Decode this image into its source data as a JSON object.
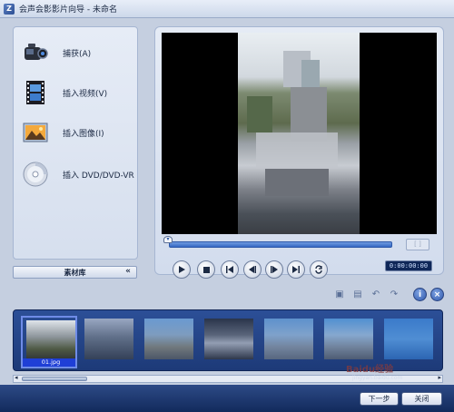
{
  "window": {
    "title": "会声会影影片向导 - 未命名"
  },
  "left_menu": {
    "items": [
      {
        "label": "捕获(A)",
        "icon": "camcorder-icon"
      },
      {
        "label": "插入视频(V)",
        "icon": "film-strip-icon"
      },
      {
        "label": "插入图像(I)",
        "icon": "picture-icon"
      },
      {
        "label": "插入 DVD/DVD-VR",
        "icon": "disc-icon"
      }
    ]
  },
  "library": {
    "label": "素材库"
  },
  "player": {
    "timecode": "0:00:00:00",
    "controls": [
      "play",
      "stop",
      "home",
      "prev-frame",
      "next-frame",
      "end",
      "repeat"
    ]
  },
  "thumbnails": [
    {
      "caption": "01.jpg",
      "selected": true
    },
    {
      "caption": "",
      "selected": false
    },
    {
      "caption": "",
      "selected": false
    },
    {
      "caption": "",
      "selected": false
    },
    {
      "caption": "",
      "selected": false
    },
    {
      "caption": "",
      "selected": false
    },
    {
      "caption": "",
      "selected": false
    }
  ],
  "buttons": {
    "next": "下一步",
    "close": "关闭"
  },
  "watermark": {
    "text": "Baidu经验",
    "sub": "jingyan.baidu.com"
  }
}
